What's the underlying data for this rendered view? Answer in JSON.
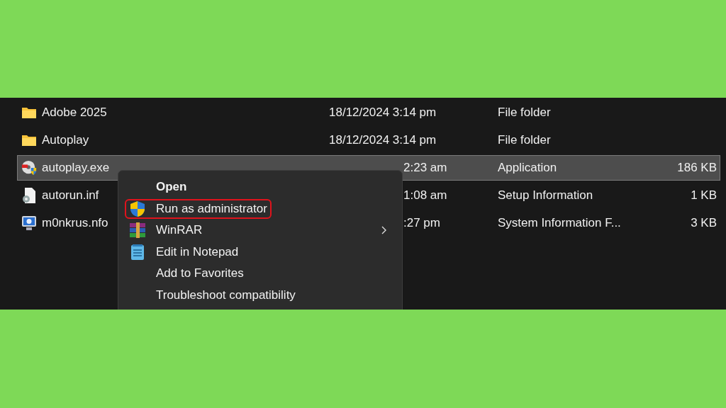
{
  "files": [
    {
      "name": "Adobe 2025",
      "kind": "folder",
      "date": "18/12/2024 3:14 pm",
      "date_partial": false,
      "type": "File folder",
      "selected": false
    },
    {
      "name": "Autoplay",
      "kind": "folder",
      "date": "18/12/2024 3:14 pm",
      "date_partial": false,
      "type": "File folder",
      "selected": false
    },
    {
      "name": "autoplay.exe",
      "kind": "app",
      "date": "2:23 am",
      "date_partial": true,
      "type": "Application",
      "size": "186 KB",
      "selected": true
    },
    {
      "name": "autorun.inf",
      "kind": "setup",
      "date": "1:08 am",
      "date_partial": true,
      "type": "Setup Information",
      "size": "1 KB",
      "selected": false
    },
    {
      "name": "m0nkrus.nfo",
      "kind": "sysinfo",
      "date": ":27 pm",
      "date_partial": true,
      "type": "System Information F...",
      "size": "3 KB",
      "selected": false
    }
  ],
  "context_menu": {
    "items": [
      {
        "label": "Open",
        "bold": true,
        "outlined": false,
        "submenu": false
      },
      {
        "label": "Run as administrator",
        "kind": "shield",
        "bold": false,
        "outlined": true,
        "submenu": false
      },
      {
        "label": "WinRAR",
        "kind": "archive",
        "bold": false,
        "outlined": false,
        "submenu": true
      },
      {
        "label": "Edit in Notepad",
        "kind": "notepad",
        "bold": false,
        "outlined": false,
        "submenu": false
      },
      {
        "label": "Add to Favorites",
        "bold": false,
        "outlined": false,
        "submenu": false
      },
      {
        "label": "Troubleshoot compatibility",
        "bold": false,
        "outlined": false,
        "submenu": false
      }
    ]
  }
}
